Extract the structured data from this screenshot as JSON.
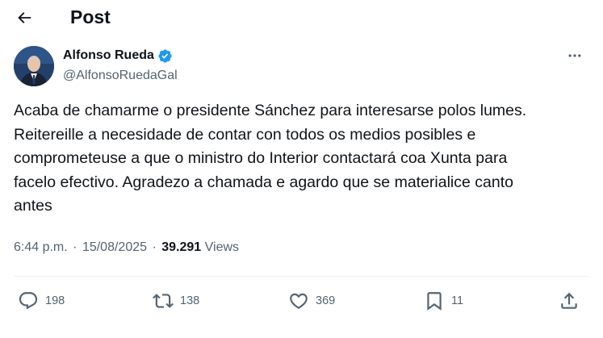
{
  "header": {
    "title": "Post"
  },
  "author": {
    "name": "Alfonso Rueda",
    "handle": "@AlfonsoRuedaGal"
  },
  "tweet": {
    "text": "Acaba de chamarme o presidente Sánchez para interesarse polos lumes.\nReitereille a necesidade de contar con todos os medios posibles e\ncomprometeuse a que o ministro do Interior contactará coa Xunta para\nfacelo efectivo. Agradezo a chamada e agardo que se materialice canto\nantes"
  },
  "meta": {
    "time": "6:44 p.m.",
    "separator": "·",
    "date": "15/08/2025",
    "views_count": "39.291",
    "views_label": "Views"
  },
  "actions": {
    "replies": "198",
    "reposts": "138",
    "likes": "369",
    "bookmarks": "11"
  },
  "icons": {
    "back": "arrow-left-icon",
    "more": "more-horizontal-icon",
    "verified": "verified-badge-icon",
    "reply": "reply-icon",
    "repost": "repost-icon",
    "like": "heart-icon",
    "bookmark": "bookmark-icon",
    "share": "share-icon"
  },
  "colors": {
    "text": "#0f1419",
    "secondary": "#536471",
    "verified": "#1d9bf0",
    "divider": "#eff3f4"
  }
}
